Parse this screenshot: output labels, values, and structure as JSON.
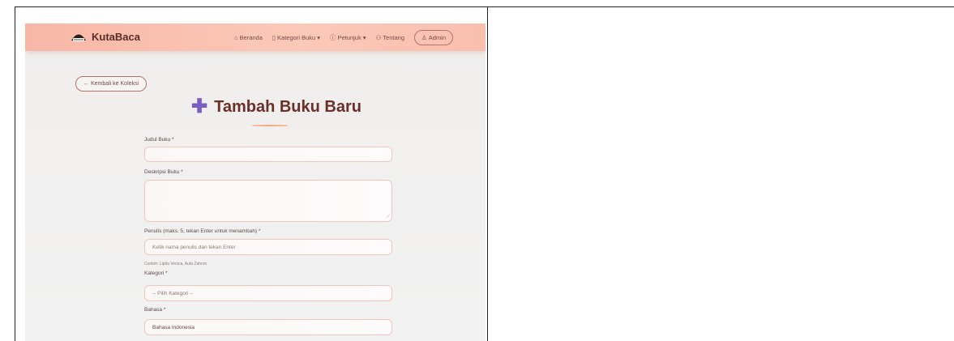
{
  "app": {
    "brand": "KutaBaca"
  },
  "navbar": {
    "items": [
      {
        "icon": "home-icon",
        "glyph": "⌂",
        "label": "Beranda"
      },
      {
        "icon": "book-icon",
        "glyph": "▯",
        "label": "Kategori Buku ▾"
      },
      {
        "icon": "info-icon",
        "glyph": "ⓘ",
        "label": "Petunjuk ▾"
      },
      {
        "icon": "people-icon",
        "glyph": "⚇",
        "label": "Tentang"
      }
    ],
    "admin": {
      "icon": "user-icon",
      "glyph": "♙",
      "label": "Admin"
    }
  },
  "back_button": "← Kembali ke Koleksi",
  "page": {
    "title": "Tambah Buku Baru",
    "title_icon": "plus-icon"
  },
  "form": {
    "judul": {
      "label": "Judul Buku *",
      "value": ""
    },
    "deskripsi": {
      "label": "Deskripsi Buku *",
      "value": ""
    },
    "penulis": {
      "label": "Penulis (maks. 5, tekan Enter untuk menambah) *",
      "placeholder": "Ketik nama penulis dan tekan Enter",
      "hint": "Contoh: Liptia Venica, Aufa Zahron"
    },
    "kategori": {
      "label": "Kategori *",
      "selected": "-- Pilih Kategori --"
    },
    "bahasa": {
      "label": "Bahasa *",
      "value": "Bahasa Indonesia"
    }
  },
  "colors": {
    "accent": "#7b5cc0",
    "title": "#6b2f2a",
    "navbar": "#f8b7a6",
    "border": "#f3c6bd"
  }
}
